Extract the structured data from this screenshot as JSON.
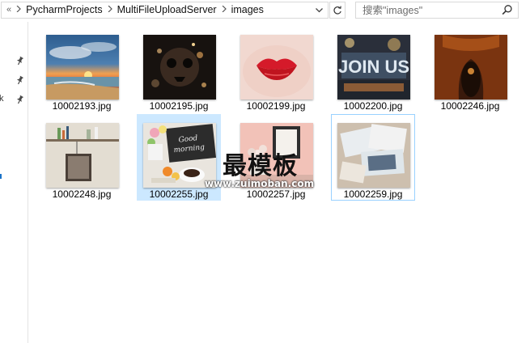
{
  "address_bar": {
    "overflow_chevron": "«",
    "breadcrumbs": [
      "PycharmProjects",
      "MultiFileUploadServer",
      "images"
    ],
    "separator": ">"
  },
  "search": {
    "placeholder": "搜索\"images\""
  },
  "nav_pane": {
    "edge_char": "k"
  },
  "files": [
    {
      "name": "10002193.jpg",
      "thumb": "sunset-beach"
    },
    {
      "name": "10002195.jpg",
      "thumb": "dark-skull-splash"
    },
    {
      "name": "10002199.jpg",
      "thumb": "red-lips"
    },
    {
      "name": "10002200.jpg",
      "thumb": "join-us-letters"
    },
    {
      "name": "10002246.jpg",
      "thumb": "amber-cave"
    },
    {
      "name": "10002248.jpg",
      "thumb": "shelf-photo-frame"
    },
    {
      "name": "10002255.jpg",
      "thumb": "good-morning-breakfast"
    },
    {
      "name": "10002257.jpg",
      "thumb": "pink-wall-frame"
    },
    {
      "name": "10002259.jpg",
      "thumb": "postcards-desk"
    }
  ],
  "selection": {
    "selected_index": 6,
    "focused_index": 8
  },
  "watermark": {
    "title": "最模板",
    "url": "www.zuimoban.com"
  }
}
